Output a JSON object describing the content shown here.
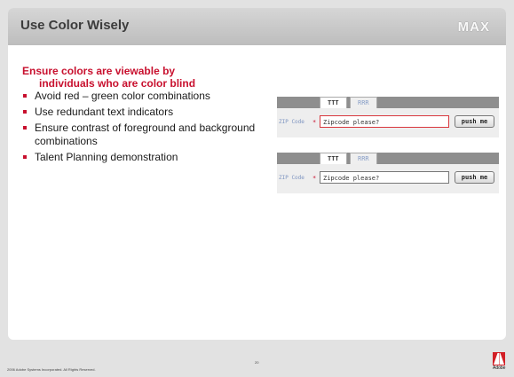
{
  "slide": {
    "title": "Use Color Wisely",
    "logo_text": "MAX",
    "heading_line1": "Ensure colors are viewable by",
    "heading_line2": "individuals who are color blind",
    "bullets": [
      "Avoid red – green color combinations",
      "Use redundant text indicators",
      "Ensure contrast of foreground and background combinations",
      "Talent Planning demonstration"
    ]
  },
  "demo": {
    "tab_active": "TTT",
    "tab_inactive": "RRR",
    "zip_label": "ZIP Code",
    "required_marker": "*",
    "input_value": "Zipcode please?",
    "button_label": "push me"
  },
  "footer": {
    "copyright": "2006 Adobe Systems Incorporated.  All Rights Reserved.",
    "page_number": "20",
    "adobe_logo_text": "Adobe"
  },
  "colors": {
    "accent_red": "#c8102e",
    "title_bar": "#c9c9c9",
    "error_border": "#d9383e"
  }
}
